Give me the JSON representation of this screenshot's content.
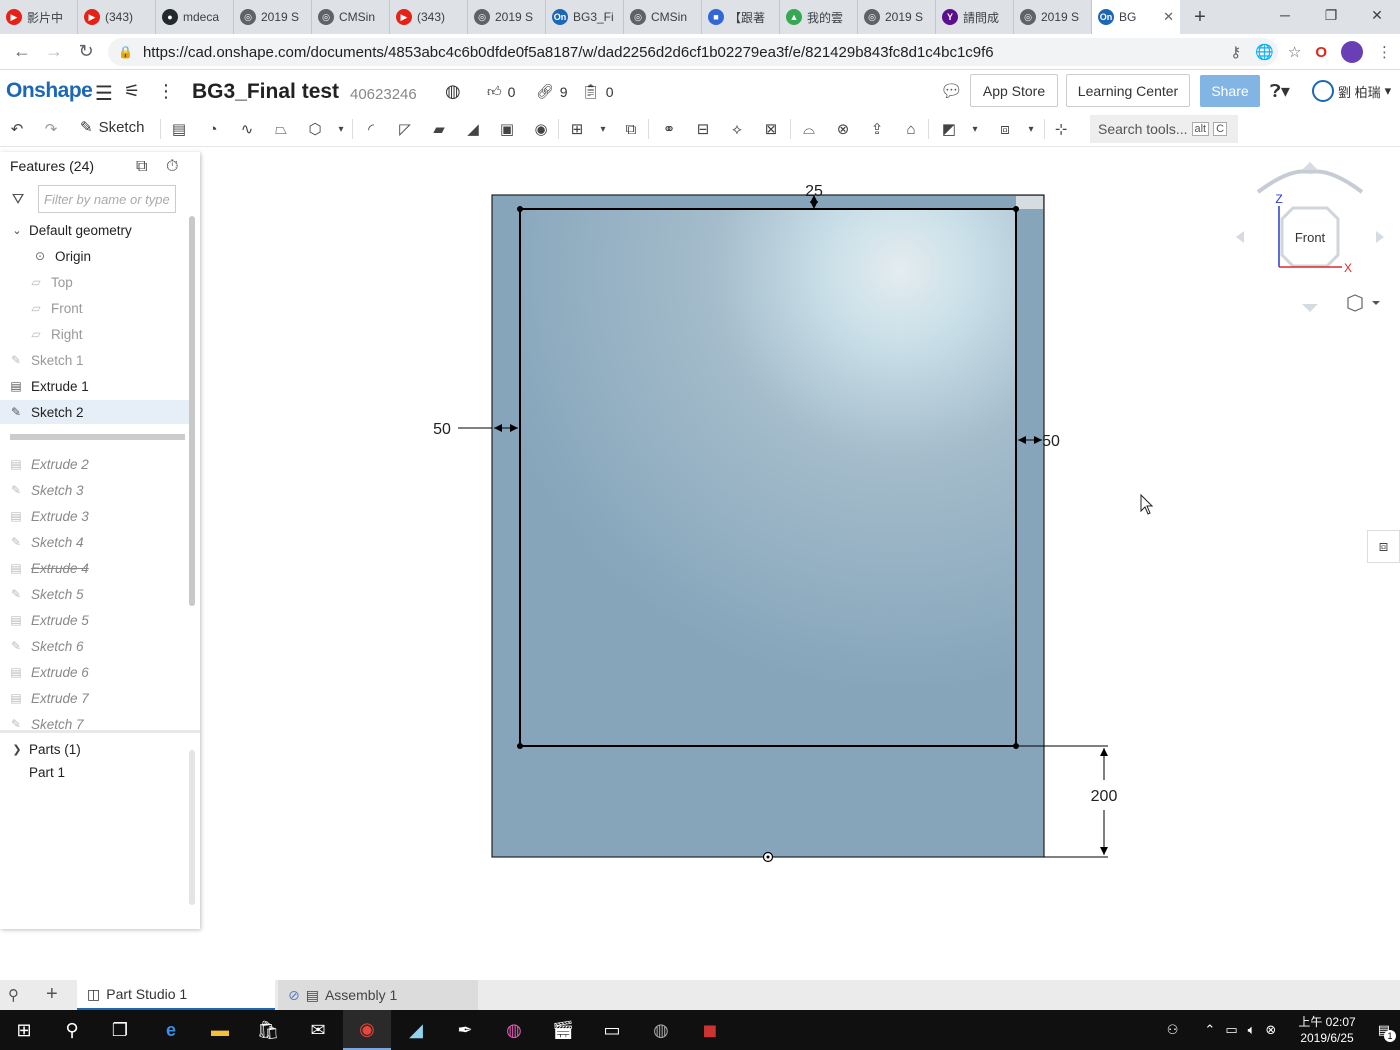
{
  "browser": {
    "tabs": [
      {
        "title": "影片中",
        "color": "#e62117",
        "glyph": "▶"
      },
      {
        "title": "(343)",
        "color": "#e62117",
        "glyph": "▶"
      },
      {
        "title": "mdeca",
        "color": "#24292e",
        "glyph": "●"
      },
      {
        "title": "2019 S",
        "color": "#5f6368",
        "glyph": "◎"
      },
      {
        "title": "CMSin",
        "color": "#5f6368",
        "glyph": "◎"
      },
      {
        "title": "(343)",
        "color": "#e62117",
        "glyph": "▶"
      },
      {
        "title": "2019 S",
        "color": "#5f6368",
        "glyph": "◎"
      },
      {
        "title": "BG3_Fi",
        "color": "#1c67b6",
        "glyph": "On"
      },
      {
        "title": "CMSin",
        "color": "#5f6368",
        "glyph": "◎"
      },
      {
        "title": "【跟著",
        "color": "#3367d6",
        "glyph": "■"
      },
      {
        "title": "我的雲",
        "color": "#34a853",
        "glyph": "▲"
      },
      {
        "title": "2019 S",
        "color": "#5f6368",
        "glyph": "◎"
      },
      {
        "title": "請問成",
        "color": "#5c0f8b",
        "glyph": "Y"
      },
      {
        "title": "2019 S",
        "color": "#5f6368",
        "glyph": "◎"
      }
    ],
    "active_tab": {
      "title": "BG",
      "color": "#1c67b6",
      "glyph": "On"
    },
    "url": "https://cad.onshape.com/documents/4853abc4c6b0dfde0f5a8187/w/dad2256d2d6cf1b02279ea3f/e/821429b843fc8d1c4bc1c9f6"
  },
  "header": {
    "logo": "Onshape",
    "doc_title": "BG3_Final test",
    "doc_id": "40623246",
    "likes": "0",
    "links": "9",
    "versions": "0",
    "app_store": "App Store",
    "learning_center": "Learning Center",
    "share": "Share",
    "user_name": "劉 柏瑞"
  },
  "toolbar": {
    "sketch_label": "Sketch",
    "search_label": "Search tools...",
    "search_key1": "alt",
    "search_key2": "C"
  },
  "features": {
    "title": "Features (24)",
    "filter_placeholder": "Filter by name or type",
    "default_geometry": "Default geometry",
    "origin": "Origin",
    "planes": [
      "Top",
      "Front",
      "Right"
    ],
    "active": [
      {
        "name": "Sketch 1",
        "kind": "sketch",
        "dim": true
      },
      {
        "name": "Extrude 1",
        "kind": "extrude",
        "dim": false
      },
      {
        "name": "Sketch 2",
        "kind": "sketch",
        "dim": false,
        "selected": true
      }
    ],
    "rolled_back": [
      {
        "name": "Extrude 2",
        "kind": "extrude"
      },
      {
        "name": "Sketch 3",
        "kind": "sketch"
      },
      {
        "name": "Extrude 3",
        "kind": "extrude"
      },
      {
        "name": "Sketch 4",
        "kind": "sketch"
      },
      {
        "name": "Extrude 4",
        "kind": "extrude",
        "strike": true
      },
      {
        "name": "Sketch 5",
        "kind": "sketch"
      },
      {
        "name": "Extrude 5",
        "kind": "extrude"
      },
      {
        "name": "Sketch 6",
        "kind": "sketch"
      },
      {
        "name": "Extrude 6",
        "kind": "extrude"
      },
      {
        "name": "Extrude 7",
        "kind": "extrude"
      },
      {
        "name": "Sketch 7",
        "kind": "sketch"
      }
    ],
    "parts_title": "Parts (1)",
    "parts": [
      "Part 1"
    ]
  },
  "viewport": {
    "dim_top": "25",
    "dim_left": "50",
    "dim_right": "50",
    "dim_bottom": "200",
    "view_label": "Front",
    "axis_z": "Z",
    "axis_x": "X",
    "body_color": "#86a5bb",
    "sketch_color": "#000000"
  },
  "bottom_tabs": {
    "part_studio": "Part Studio 1",
    "assembly": "Assembly 1"
  },
  "taskbar": {
    "time": "上午 02:07",
    "date": "2019/6/25",
    "notifications": "1"
  }
}
